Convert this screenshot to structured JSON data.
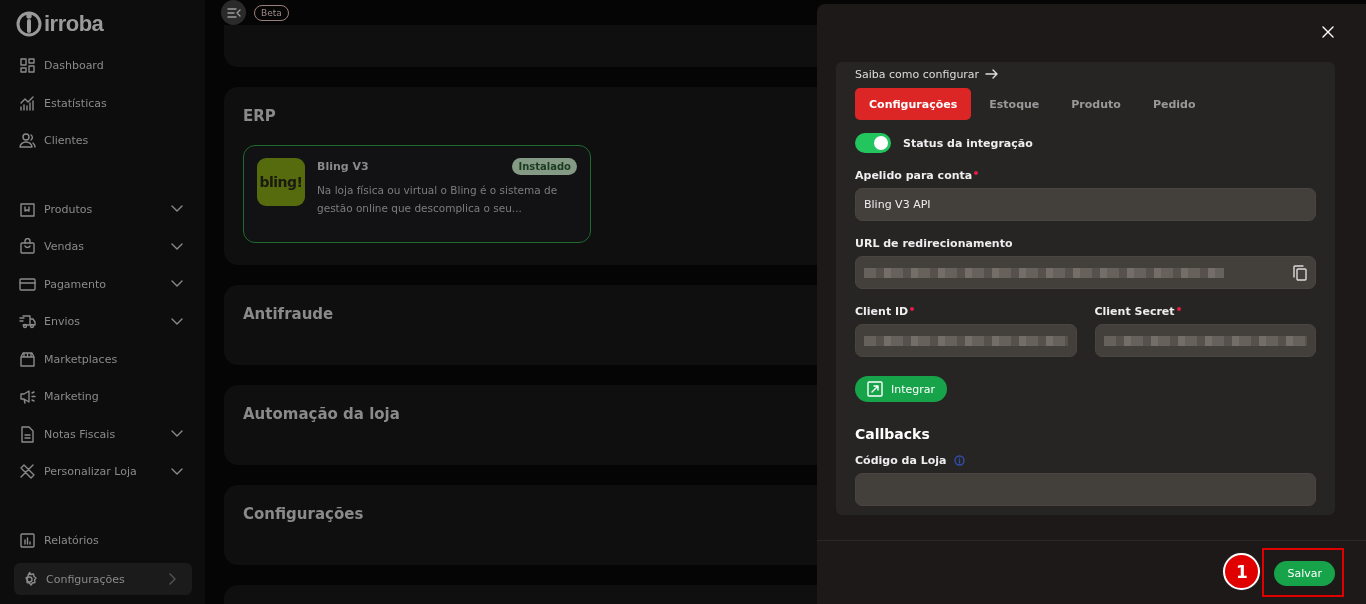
{
  "sidebar": {
    "logo": "irroba",
    "sections": [
      [
        {
          "label": "Dashboard",
          "kind": "plain",
          "selected": false
        },
        {
          "label": "Estatísticas",
          "kind": "plain",
          "selected": false
        },
        {
          "label": "Clientes",
          "kind": "plain",
          "selected": false
        }
      ],
      [
        {
          "label": "Produtos",
          "kind": "dropdown",
          "selected": false
        },
        {
          "label": "Vendas",
          "kind": "dropdown",
          "selected": false
        },
        {
          "label": "Pagamento",
          "kind": "dropdown",
          "selected": false
        },
        {
          "label": "Envios",
          "kind": "dropdown",
          "selected": false
        },
        {
          "label": "Marketplaces",
          "kind": "plain",
          "selected": false
        },
        {
          "label": "Marketing",
          "kind": "plain",
          "selected": false
        },
        {
          "label": "Notas Fiscais",
          "kind": "dropdown",
          "selected": false
        },
        {
          "label": "Personalizar Loja",
          "kind": "dropdown",
          "selected": false
        }
      ],
      [
        {
          "label": "Relatórios",
          "kind": "plain",
          "selected": false
        },
        {
          "label": "Configurações",
          "kind": "submenu",
          "selected": true
        }
      ]
    ]
  },
  "topbar": {
    "badge": "Beta"
  },
  "sections": [
    {
      "title": "ERP",
      "apps": [
        {
          "name": "Bling V3",
          "status": "Instalado",
          "installed": true,
          "logo": "bling!",
          "description": "Na loja física ou virtual o Bling é o sistema de gestão online que descomplica o seu..."
        }
      ]
    },
    {
      "title": "Antifraude"
    },
    {
      "title": "Automação da loja"
    },
    {
      "title": "Configurações"
    }
  ],
  "drawer": {
    "help_link": "Saiba como configurar",
    "tabs": [
      {
        "label": "Configurações",
        "selected": true
      },
      {
        "label": "Estoque",
        "selected": false
      },
      {
        "label": "Produto",
        "selected": false
      },
      {
        "label": "Pedido",
        "selected": false
      }
    ],
    "toggle": {
      "label": "Status da integração",
      "on": true
    },
    "fields": [
      {
        "label": "Apelido para conta",
        "required": true,
        "value": "Bling V3 API",
        "kind": "text"
      },
      {
        "label": "URL de redirecionamento",
        "required": false,
        "kind": "copy"
      }
    ],
    "credentials": [
      {
        "label": "Client ID",
        "required": true
      },
      {
        "label": "Client Secret",
        "required": true
      }
    ],
    "integrate_button": "Integrar",
    "callbacks_title": "Callbacks",
    "store_code_label": "Código da Loja",
    "save_button": "Salvar",
    "annotation": "1"
  }
}
